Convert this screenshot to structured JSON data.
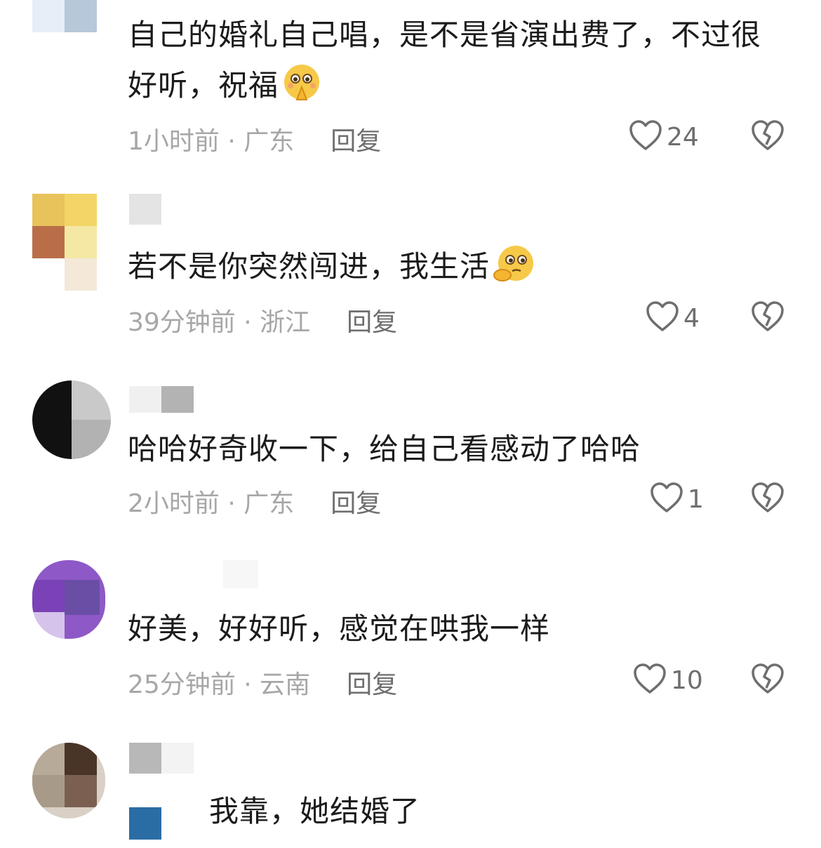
{
  "comments": [
    {
      "text": "自己的婚礼自己唱，是不是省演出费了，不过很好听，祝福",
      "emoji": "praying-face-emoji",
      "time_location": "1小时前 · 广东",
      "reply": "回复",
      "likes": "24"
    },
    {
      "text": "若不是你突然闯进，我生活",
      "emoji": "thinking-face-emoji",
      "time_location": "39分钟前 · 浙江",
      "reply": "回复",
      "likes": "4"
    },
    {
      "text": "哈哈好奇收一下，给自己看感动了哈哈",
      "time_location": "2小时前 · 广东",
      "reply": "回复",
      "likes": "1"
    },
    {
      "text": "好美，好好听，感觉在哄我一样",
      "time_location": "25分钟前 · 云南",
      "reply": "回复",
      "likes": "10"
    },
    {
      "text": "我靠，她结婚了"
    }
  ],
  "icons": {
    "like": "heart-outline-icon",
    "dislike": "broken-heart-icon"
  },
  "colors": {
    "text": "#1b1b1b",
    "meta": "#a7a7a7",
    "action": "#6e6e6e"
  }
}
